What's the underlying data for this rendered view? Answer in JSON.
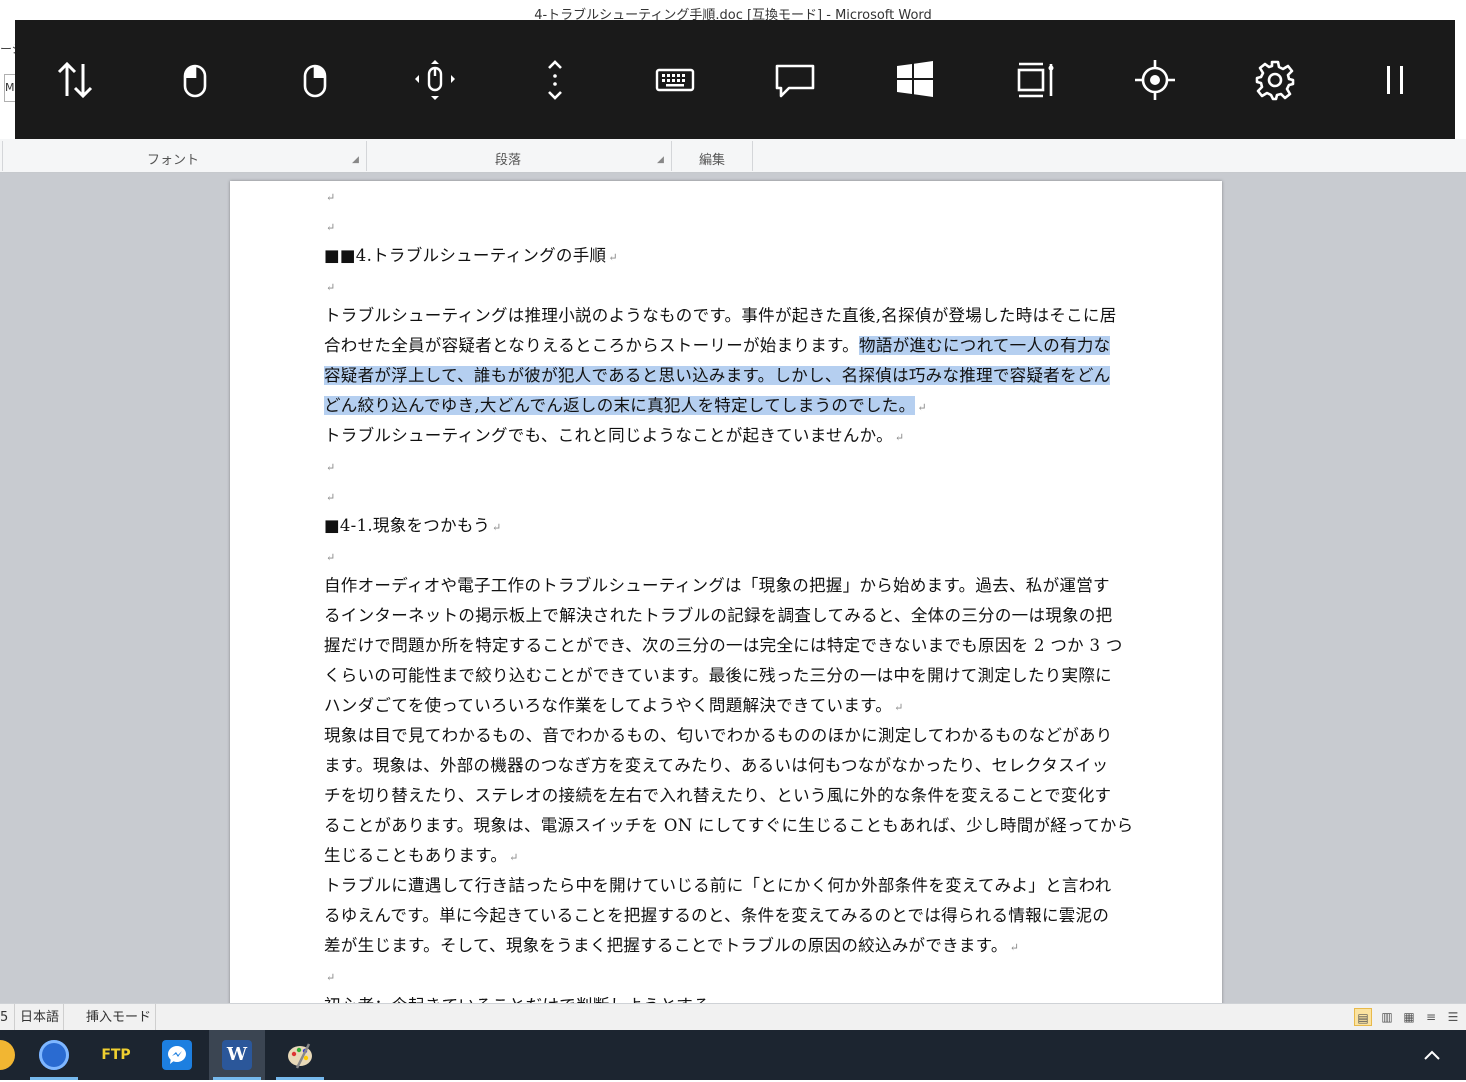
{
  "window": {
    "title": "4-トラブルシューティング手順.doc [互換モード] - Microsoft Word",
    "left_edge_text": "ージ",
    "left_edge_box": "M"
  },
  "overlay": {
    "buttons": [
      {
        "icon": "swap-vertical-icon"
      },
      {
        "icon": "mouse-left-click-icon"
      },
      {
        "icon": "mouse-right-click-icon"
      },
      {
        "icon": "mouse-move-icon"
      },
      {
        "icon": "scroll-vertical-icon"
      },
      {
        "icon": "keyboard-icon"
      },
      {
        "icon": "chat-bubble-icon"
      },
      {
        "icon": "windows-logo-icon"
      },
      {
        "icon": "window-resize-icon"
      },
      {
        "icon": "target-crosshair-icon"
      },
      {
        "icon": "gear-icon"
      },
      {
        "icon": "pause-icon"
      }
    ]
  },
  "ribbon": {
    "groups": [
      {
        "label": "フォント"
      },
      {
        "label": "段落"
      },
      {
        "label": "編集"
      }
    ]
  },
  "document": {
    "return_mark": "↵",
    "lines": [
      {
        "text": "",
        "mark": true,
        "selected": false
      },
      {
        "text": "",
        "mark": true,
        "selected": false
      },
      {
        "text": "■■4.トラブルシューティングの手順",
        "mark": true,
        "selected": false
      },
      {
        "text": "",
        "mark": true,
        "selected": false
      },
      {
        "text": "トラブルシューティングは推理小説のようなものです。事件が起きた直後,名探偵が登場した時はそこに居",
        "mark": false,
        "selected": false
      },
      {
        "text": "合わせた全員が容疑者となりえるところからストーリーが始まります。",
        "text2": "物語が進むにつれて一人の有力な",
        "mark": false,
        "selected": false
      },
      {
        "text": "容疑者が浮上して、誰もが彼が犯人であると思い込みます。しかし、名探偵は巧みな推理で容疑者をどん",
        "mark": false,
        "selected": true
      },
      {
        "text": "どん絞り込んでゆき,大どんでん返しの末に真犯人を特定してしまうのでした。",
        "mark": true,
        "selected": true
      },
      {
        "text": "トラブルシューティングでも、これと同じようなことが起きていませんか。",
        "mark": true,
        "selected": false
      },
      {
        "text": "",
        "mark": true,
        "selected": false
      },
      {
        "text": "",
        "mark": true,
        "selected": false
      },
      {
        "text": "■4-1.現象をつかもう",
        "mark": true,
        "selected": false
      },
      {
        "text": "",
        "mark": true,
        "selected": false
      },
      {
        "text": "自作オーディオや電子工作のトラブルシューティングは「現象の把握」から始めます。過去、私が運営す",
        "mark": false,
        "selected": false
      },
      {
        "text": "るインターネットの掲示板上で解決されたトラブルの記録を調査してみると、全体の三分の一は現象の把",
        "mark": false,
        "selected": false
      },
      {
        "text": "握だけで問題か所を特定することができ、次の三分の一は完全には特定できないまでも原因を 2 つか 3 つ",
        "mark": false,
        "selected": false
      },
      {
        "text": "くらいの可能性まで絞り込むことができています。最後に残った三分の一は中を開けて測定したり実際に",
        "mark": false,
        "selected": false
      },
      {
        "text": "ハンダごてを使っていろいろな作業をしてようやく問題解決できています。",
        "mark": true,
        "selected": false
      },
      {
        "text": "現象は目で見てわかるもの、音でわかるもの、匂いでわかるもののほかに測定してわかるものなどがあり",
        "mark": false,
        "selected": false
      },
      {
        "text": "ます。現象は、外部の機器のつなぎ方を変えてみたり、あるいは何もつながなかったり、セレクタスイッ",
        "mark": false,
        "selected": false
      },
      {
        "text": "チを切り替えたり、ステレオの接続を左右で入れ替えたり、という風に外的な条件を変えることで変化す",
        "mark": false,
        "selected": false
      },
      {
        "text": "ることがあります。現象は、電源スイッチを ON にしてすぐに生じることもあれば、少し時間が経ってから",
        "mark": false,
        "selected": false
      },
      {
        "text": "生じることもあります。",
        "mark": true,
        "selected": false
      },
      {
        "text": "トラブルに遭遇して行き詰ったら中を開けていじる前に「とにかく何か外部条件を変えてみよ」と言われ",
        "mark": false,
        "selected": false
      },
      {
        "text": "るゆえんです。単に今起きていることを把握するのと、条件を変えてみるのとでは得られる情報に雲泥の",
        "mark": false,
        "selected": false
      },
      {
        "text": "差が生じます。そして、現象をうまく把握することでトラブルの原因の絞込みができます。",
        "mark": true,
        "selected": false
      },
      {
        "text": "",
        "mark": true,
        "selected": false
      },
      {
        "text": "初心者：今起きていることだけで判断しようとする。",
        "mark": true,
        "selected": false
      }
    ]
  },
  "statusbar": {
    "page_fragment": "5",
    "language": "日本語",
    "mode": "挿入モード"
  },
  "taskbar": {
    "apps": [
      {
        "icon": "folder-icon",
        "label": ""
      },
      {
        "icon": "web-browser-icon",
        "label": ""
      },
      {
        "icon": "ftp-client-icon",
        "label": "FTP"
      },
      {
        "icon": "messenger-icon",
        "label": ""
      },
      {
        "icon": "word-icon",
        "label": "W"
      },
      {
        "icon": "paint-palette-icon",
        "label": ""
      }
    ]
  },
  "colors": {
    "overlay_bg": "#1a1a1a",
    "selection": "#b5cff0",
    "taskbar_bg": "#1c2530",
    "running_indicator": "#76b9ed"
  }
}
